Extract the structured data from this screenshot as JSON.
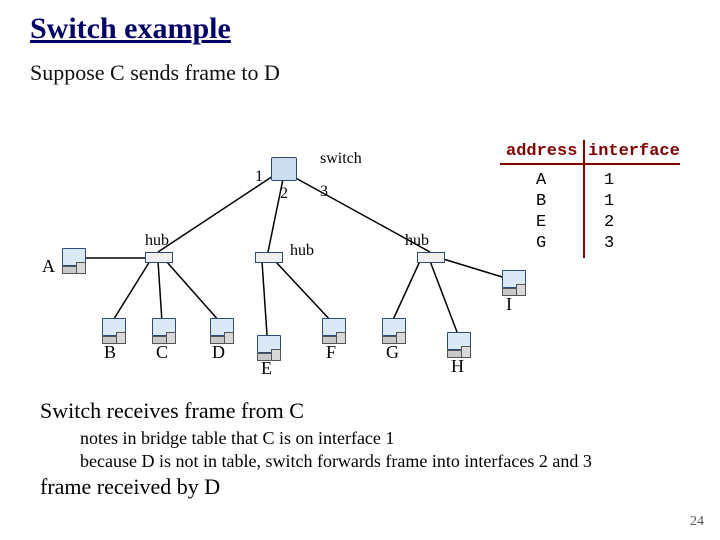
{
  "title": "Switch example",
  "subtitle": "Suppose C sends frame to D",
  "labels": {
    "switch_name": "switch",
    "hub_name": "hub",
    "portnums": {
      "p1": "1",
      "p2": "2",
      "p3": "3"
    }
  },
  "hosts": {
    "A": "A",
    "B": "B",
    "C": "C",
    "D": "D",
    "E": "E",
    "F": "F",
    "G": "G",
    "H": "H",
    "I": "I"
  },
  "table": {
    "hdr_addr": "address",
    "hdr_if": "interface",
    "rows": [
      {
        "addr": "A",
        "iface": "1"
      },
      {
        "addr": "B",
        "iface": "1"
      },
      {
        "addr": "E",
        "iface": "2"
      },
      {
        "addr": "G",
        "iface": "3"
      }
    ]
  },
  "body": {
    "l1": "Switch receives frame from C",
    "l2": "notes in bridge table that C is on interface 1",
    "l3": "because D is not in table, switch forwards frame into interfaces 2 and 3",
    "l4": "frame received by D"
  },
  "pgnum": "24"
}
